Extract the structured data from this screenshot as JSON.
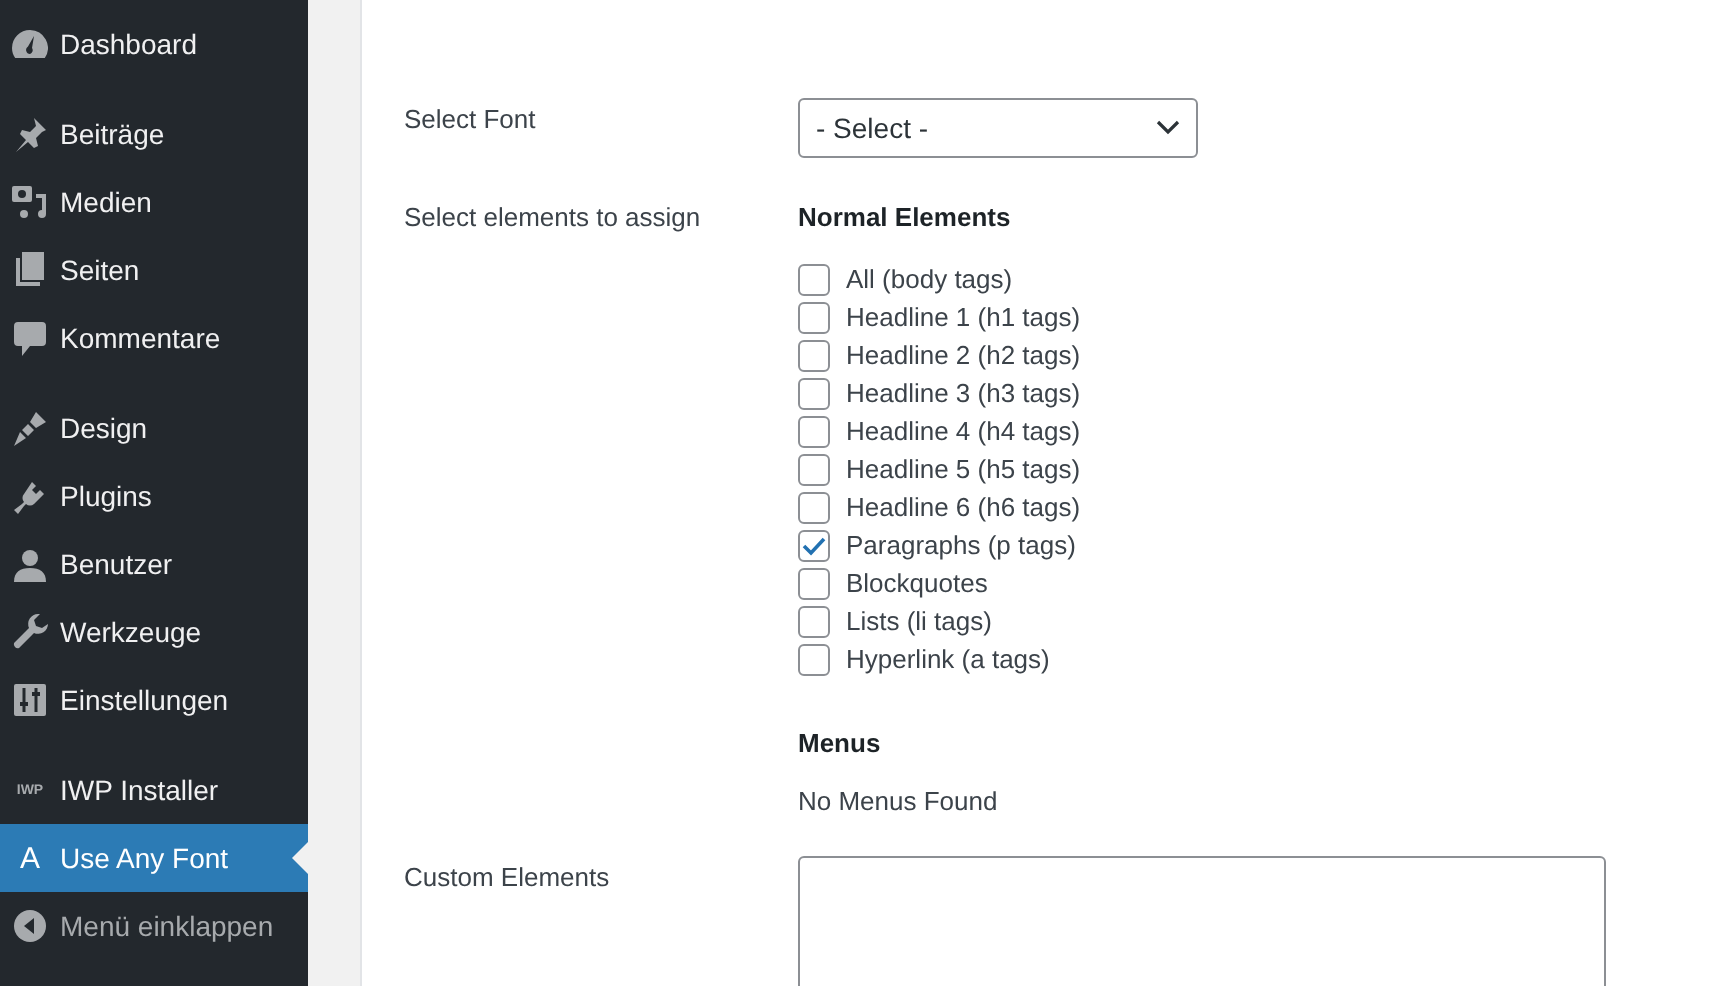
{
  "sidebar": {
    "groups": [
      [
        {
          "label": "Dashboard",
          "selected": false
        }
      ],
      [
        {
          "label": "Beiträge",
          "selected": false
        },
        {
          "label": "Medien",
          "selected": false
        },
        {
          "label": "Seiten",
          "selected": false
        },
        {
          "label": "Kommentare",
          "selected": false
        }
      ],
      [
        {
          "label": "Design",
          "selected": false
        },
        {
          "label": "Plugins",
          "selected": false
        },
        {
          "label": "Benutzer",
          "selected": false
        },
        {
          "label": "Werkzeuge",
          "selected": false
        },
        {
          "label": "Einstellungen",
          "selected": false
        }
      ],
      [
        {
          "label": "IWP Installer",
          "selected": false,
          "icon_text": "IWP"
        },
        {
          "label": "Use Any Font",
          "selected": true,
          "icon_text": "A"
        }
      ]
    ],
    "collapse": {
      "label": "Menü einklappen"
    }
  },
  "form": {
    "font": {
      "label": "Select Font",
      "value": "- Select -"
    },
    "elements": {
      "label": "Select elements to assign",
      "heading": "Normal Elements",
      "options": [
        {
          "label": "All (body tags)",
          "checked": false
        },
        {
          "label": "Headline 1 (h1 tags)",
          "checked": false
        },
        {
          "label": "Headline 2 (h2 tags)",
          "checked": false
        },
        {
          "label": "Headline 3 (h3 tags)",
          "checked": false
        },
        {
          "label": "Headline 4 (h4 tags)",
          "checked": false
        },
        {
          "label": "Headline 5 (h5 tags)",
          "checked": false
        },
        {
          "label": "Headline 6 (h6 tags)",
          "checked": false
        },
        {
          "label": "Paragraphs (p tags)",
          "checked": true
        },
        {
          "label": "Blockquotes",
          "checked": false
        },
        {
          "label": "Lists (li tags)",
          "checked": false
        },
        {
          "label": "Hyperlink (a tags)",
          "checked": false
        }
      ],
      "menus_heading": "Menus",
      "menus_text": "No Menus Found"
    },
    "custom": {
      "label": "Custom Elements"
    }
  }
}
